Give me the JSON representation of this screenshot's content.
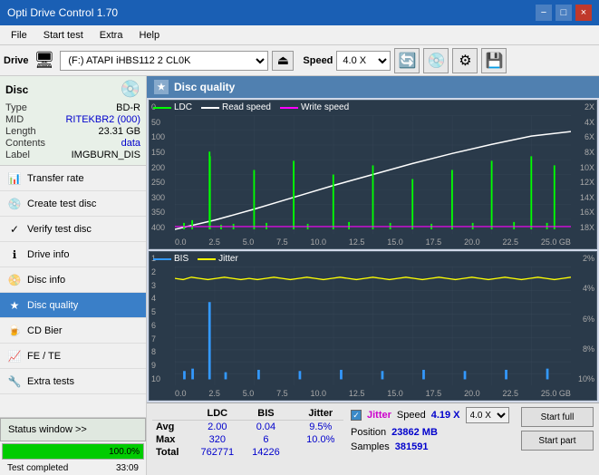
{
  "titlebar": {
    "title": "Opti Drive Control 1.70",
    "minimize_label": "−",
    "maximize_label": "□",
    "close_label": "×"
  },
  "menubar": {
    "items": [
      "File",
      "Start test",
      "Extra",
      "Help"
    ]
  },
  "toolbar": {
    "drive_label": "Drive",
    "drive_value": "(F:)  ATAPI iHBS112  2 CL0K",
    "speed_label": "Speed",
    "speed_value": "4.0 X"
  },
  "disc": {
    "title": "Disc",
    "type_label": "Type",
    "type_value": "BD-R",
    "mid_label": "MID",
    "mid_value": "RITEKBR2 (000)",
    "length_label": "Length",
    "length_value": "23.31 GB",
    "contents_label": "Contents",
    "contents_value": "data",
    "label_label": "Label",
    "label_value": "IMGBURN_DIS"
  },
  "nav_items": [
    {
      "id": "transfer-rate",
      "label": "Transfer rate",
      "icon": "📊"
    },
    {
      "id": "create-test-disc",
      "label": "Create test disc",
      "icon": "💿"
    },
    {
      "id": "verify-test-disc",
      "label": "Verify test disc",
      "icon": "✓"
    },
    {
      "id": "drive-info",
      "label": "Drive info",
      "icon": "ℹ"
    },
    {
      "id": "disc-info",
      "label": "Disc info",
      "icon": "📀"
    },
    {
      "id": "disc-quality",
      "label": "Disc quality",
      "icon": "★",
      "active": true
    },
    {
      "id": "cd-bier",
      "label": "CD Bier",
      "icon": "🍺"
    },
    {
      "id": "fe-te",
      "label": "FE / TE",
      "icon": "📈"
    },
    {
      "id": "extra-tests",
      "label": "Extra tests",
      "icon": "🔧"
    }
  ],
  "status": {
    "btn_label": "Status window >>",
    "progress": 100,
    "progress_text": "100.0%",
    "status_text": "Test completed",
    "time_text": "33:09"
  },
  "panel": {
    "title": "Disc quality",
    "icon": "★"
  },
  "chart1": {
    "legend": [
      {
        "label": "LDC",
        "color": "#00ff00"
      },
      {
        "label": "Read speed",
        "color": "#ffffff"
      },
      {
        "label": "Write speed",
        "color": "#ff00ff"
      }
    ],
    "y_labels_left": [
      "0",
      "50",
      "100",
      "150",
      "200",
      "250",
      "300",
      "350",
      "400"
    ],
    "y_labels_right": [
      "2X",
      "4X",
      "6X",
      "8X",
      "10X",
      "12X",
      "14X",
      "16X",
      "18X"
    ],
    "x_labels": [
      "0.0",
      "2.5",
      "5.0",
      "7.5",
      "10.0",
      "12.5",
      "15.0",
      "17.5",
      "20.0",
      "22.5",
      "25.0 GB"
    ]
  },
  "chart2": {
    "legend": [
      {
        "label": "BIS",
        "color": "#3399ff"
      },
      {
        "label": "Jitter",
        "color": "#ffff00"
      }
    ],
    "y_labels_left": [
      "1",
      "2",
      "3",
      "4",
      "5",
      "6",
      "7",
      "8",
      "9",
      "10"
    ],
    "y_labels_right": [
      "2%",
      "4%",
      "6%",
      "8%",
      "10%"
    ],
    "x_labels": [
      "0.0",
      "2.5",
      "5.0",
      "7.5",
      "10.0",
      "12.5",
      "15.0",
      "17.5",
      "20.0",
      "22.5",
      "25.0 GB"
    ]
  },
  "stats": {
    "headers": [
      "LDC",
      "BIS",
      "",
      "Jitter"
    ],
    "rows": [
      {
        "label": "Avg",
        "ldc": "2.00",
        "bis": "0.04",
        "jitter": "9.5%"
      },
      {
        "label": "Max",
        "ldc": "320",
        "bis": "6",
        "jitter": "10.0%"
      },
      {
        "label": "Total",
        "ldc": "762771",
        "bis": "14226",
        "jitter": ""
      }
    ],
    "jitter_checked": true,
    "jitter_label": "Jitter",
    "speed_label": "Speed",
    "speed_value": "4.19 X",
    "speed_select": "4.0 X",
    "position_label": "Position",
    "position_value": "23862 MB",
    "samples_label": "Samples",
    "samples_value": "381591",
    "btn_full": "Start full",
    "btn_part": "Start part"
  }
}
